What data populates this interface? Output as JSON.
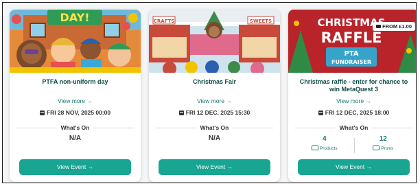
{
  "events": [
    {
      "hero_text": "DAY!",
      "title": "PTFA non-uniform day",
      "view_more": "View more →",
      "date": "FRI 28 NOV, 2025 00:00",
      "whats_on_label": "What's On",
      "whats_on_value": "N/A",
      "button": "View Event →"
    },
    {
      "hero_signs": [
        "CRAFTS",
        "SWEETS"
      ],
      "title": "Christmas Fair",
      "view_more": "View more →",
      "date": "FRI 12 DEC, 2025 15:30",
      "whats_on_label": "What's On",
      "whats_on_value": "N/A",
      "button": "View Event →"
    },
    {
      "hero_text": [
        "CHRISTMAS",
        "RAFFLE",
        "PTA",
        "FUNDRAISER"
      ],
      "price_badge": "FROM £1.00",
      "title": "Christmas raffle - enter for chance to win MetaQuest 3",
      "view_more": "View more →",
      "date": "FRI 12 DEC, 2025 18:00",
      "whats_on_label": "What's On",
      "stats": [
        {
          "value": "4",
          "label": "Products"
        },
        {
          "value": "12",
          "label": "Prizes"
        }
      ],
      "button": "View Event →"
    }
  ],
  "colors": {
    "accent": "#18a592",
    "title": "#0d4a45",
    "link": "#157a72"
  }
}
